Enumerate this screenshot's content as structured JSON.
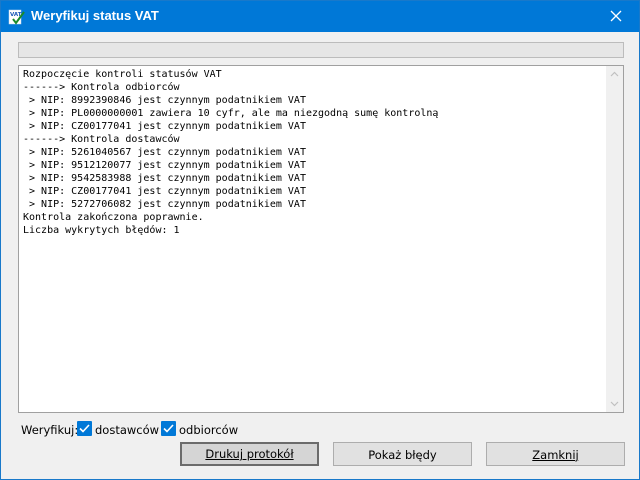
{
  "window": {
    "title": "Weryfikuj status VAT",
    "icon": "vat-app-icon",
    "icon_text": "VAT",
    "close_icon": "close-icon"
  },
  "progress": {
    "value": 0
  },
  "log": {
    "lines": [
      "Rozpoczęcie kontroli statusów VAT",
      "------> Kontrola odbiorców",
      " > NIP: 8992390846 jest czynnym podatnikiem VAT",
      " > NIP: PL0000000001 zawiera 10 cyfr, ale ma niezgodną sumę kontrolną",
      " > NIP: CZ00177041 jest czynnym podatnikiem VAT",
      "------> Kontrola dostawców",
      " > NIP: 5261040567 jest czynnym podatnikiem VAT",
      " > NIP: 9512120077 jest czynnym podatnikiem VAT",
      " > NIP: 9542583988 jest czynnym podatnikiem VAT",
      " > NIP: CZ00177041 jest czynnym podatnikiem VAT",
      " > NIP: 5272706082 jest czynnym podatnikiem VAT",
      "Kontrola zakończona poprawnie.",
      "Liczba wykrytych błędów: 1"
    ]
  },
  "verify": {
    "label": "Weryfikuj:",
    "dostawcow": {
      "label": "dostawców",
      "checked": true
    },
    "odbiorcow": {
      "label": "odbiorców",
      "checked": true
    }
  },
  "buttons": {
    "print": "Drukuj protokół",
    "errors": "Pokaż błędy",
    "close": "Zamknij"
  },
  "colors": {
    "titlebar": "#0078d7",
    "checkbox": "#0078d7"
  }
}
